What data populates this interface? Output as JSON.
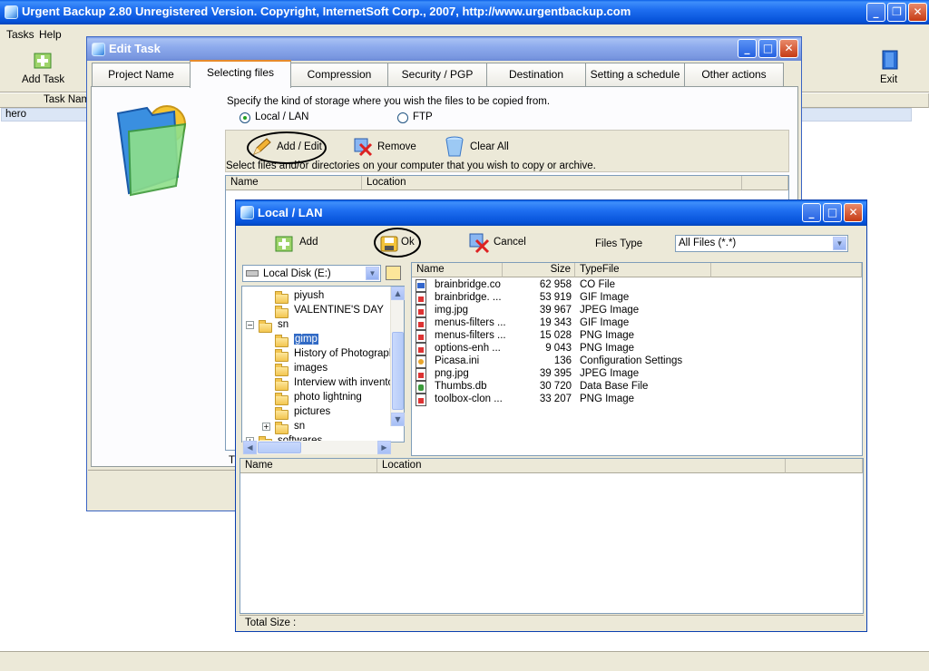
{
  "main_window": {
    "title": "Urgent Backup 2.80   Unregistered Version.  Copyright,  InternetSoft Corp., 2007,   http://www.urgentbackup.com",
    "menu": [
      "Tasks",
      "Help"
    ],
    "toolbar": {
      "add_task": "Add Task",
      "exit": "Exit"
    },
    "list_header": "Task Name",
    "rows": [
      "hero"
    ]
  },
  "edit_task": {
    "title": "Edit Task",
    "tabs": [
      "Project Name",
      "Selecting files",
      "Compression",
      "Security / PGP",
      "Destination",
      "Setting a schedule",
      "Other actions"
    ],
    "storage_prompt": "Specify the kind of storage where you wish the files to be copied from.",
    "radio_local": "Local / LAN",
    "radio_ftp": "FTP",
    "add_edit": "Add / Edit",
    "remove": "Remove",
    "clear_all": "Clear All",
    "hint": "Select files and/or directories on your computer that you wish to copy or archive.",
    "col_name": "Name",
    "col_location": "Location",
    "stub": "T"
  },
  "local_lan": {
    "title": "Local / LAN",
    "add": "Add",
    "ok": "Ok",
    "cancel": "Cancel",
    "files_type_label": "Files Type",
    "files_type_value": "All Files (*.*)",
    "drive": "Local Disk (E:)",
    "tree": [
      {
        "label": "piyush",
        "indent": 2
      },
      {
        "label": "VALENTINE'S DAY",
        "indent": 2
      },
      {
        "label": "sn",
        "indent": 1,
        "expander": "−"
      },
      {
        "label": "gimp",
        "indent": 2,
        "selected": true
      },
      {
        "label": "History of Photography",
        "indent": 2
      },
      {
        "label": "images",
        "indent": 2
      },
      {
        "label": "Interview with inventor",
        "indent": 2
      },
      {
        "label": "photo lightning",
        "indent": 2
      },
      {
        "label": "pictures",
        "indent": 2
      },
      {
        "label": "sn",
        "indent": 2,
        "expander": "+"
      },
      {
        "label": "softwares",
        "indent": 1,
        "expander": "+"
      }
    ],
    "file_headers": {
      "name": "Name",
      "size": "Size",
      "type": "TypeFile"
    },
    "files": [
      {
        "name": "brainbridge.co",
        "size": "62 958",
        "type": "CO File",
        "icon": "co"
      },
      {
        "name": "brainbridge. ...",
        "size": "53 919",
        "type": "GIF Image",
        "icon": "img"
      },
      {
        "name": "img.jpg",
        "size": "39 967",
        "type": "JPEG Image",
        "icon": "img"
      },
      {
        "name": "menus-filters ...",
        "size": "19 343",
        "type": "GIF Image",
        "icon": "img"
      },
      {
        "name": "menus-filters ...",
        "size": "15 028",
        "type": "PNG Image",
        "icon": "img"
      },
      {
        "name": "options-enh ...",
        "size": "9 043",
        "type": "PNG Image",
        "icon": "img"
      },
      {
        "name": "Picasa.ini",
        "size": "136",
        "type": "Configuration Settings",
        "icon": "ini"
      },
      {
        "name": "png.jpg",
        "size": "39 395",
        "type": "JPEG Image",
        "icon": "img"
      },
      {
        "name": "Thumbs.db",
        "size": "30 720",
        "type": "Data Base File",
        "icon": "db"
      },
      {
        "name": "toolbox-clon ...",
        "size": "33 207",
        "type": "PNG Image",
        "icon": "img"
      }
    ],
    "lower_headers": {
      "name": "Name",
      "location": "Location"
    },
    "total_size": "Total Size :"
  }
}
